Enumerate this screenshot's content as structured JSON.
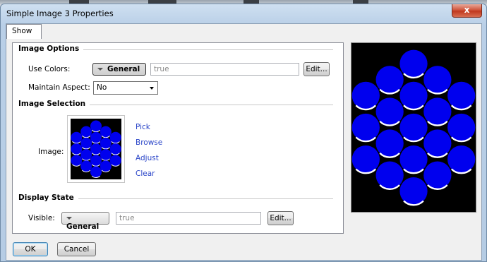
{
  "window": {
    "title": "Simple Image 3 Properties",
    "close_glyph": "x"
  },
  "tabs": [
    {
      "label": "Show"
    }
  ],
  "image_options": {
    "title": "Image Options",
    "use_colors": {
      "label": "Use Colors:",
      "mode": "General",
      "value": "true",
      "edit": "Edit..."
    },
    "maintain_aspect": {
      "label": "Maintain Aspect:",
      "selected": "No"
    }
  },
  "image_selection": {
    "title": "Image Selection",
    "image_label": "Image:",
    "links": [
      "Pick",
      "Browse",
      "Adjust",
      "Clear"
    ]
  },
  "display_state": {
    "title": "Display State",
    "visible": {
      "label": "Visible:",
      "mode": "General",
      "value": "true",
      "edit": "Edit..."
    }
  },
  "footer": {
    "ok": "OK",
    "cancel": "Cancel"
  },
  "image": {
    "background": "#000000",
    "circle_color": "#0000ee",
    "circle_highlight": "#ffffff",
    "columns": [
      3,
      4,
      5,
      4,
      3
    ],
    "count": 19
  }
}
